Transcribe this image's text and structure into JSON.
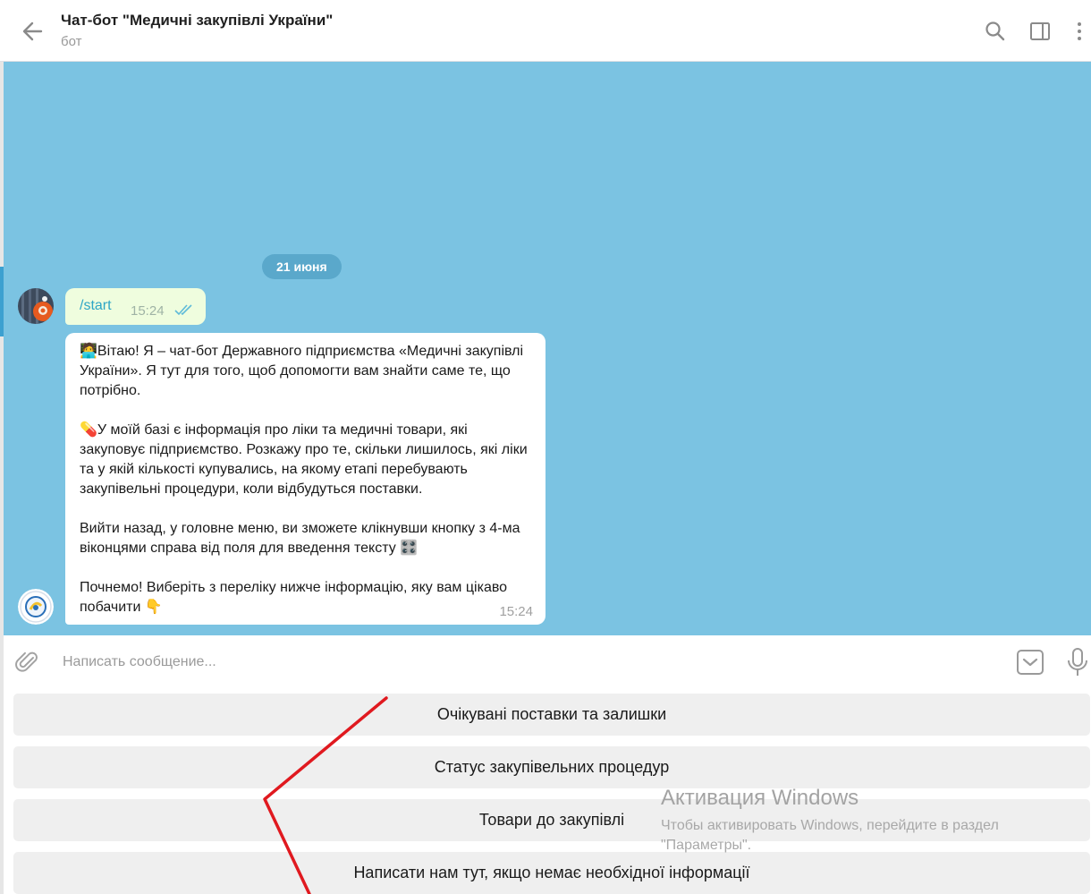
{
  "header": {
    "title": "Чат-бот \"Медичні закупівлі України\"",
    "subtitle": "бот"
  },
  "chat": {
    "date_label": "21 июня",
    "outgoing": {
      "text": "/start",
      "time": "15:24"
    },
    "incoming": {
      "paragraphs": [
        "🧑‍💻Вітаю! Я – чат-бот Державного підприємства «Медичні закупівлі України». Я тут для того, щоб допомогти вам знайти саме те, що потрібно.",
        "💊У моїй базі є інформація про ліки та медичні товари, які закуповує підприємство. Розкажу про те, скільки лишилось, які ліки та у якій кількості купувались, на якому етапі перебувають закупівельні процедури, коли відбудуться поставки.",
        "Вийти назад, у головне меню, ви зможете клікнувши кнопку з 4-ма віконцями справа від поля для введення тексту 🎛️",
        "Почнемо! Виберіть з переліку нижче інформацію, яку вам цікаво побачити 👇"
      ],
      "time": "15:24"
    }
  },
  "composer": {
    "placeholder": "Написать сообщение..."
  },
  "keyboard": {
    "buttons": [
      "Очікувані поставки та залишки",
      "Статус закупівельних процедур",
      "Товари до закупівлі",
      "Написати нам тут, якщо немає необхідної інформації"
    ]
  },
  "watermark": {
    "title": "Активация Windows",
    "text": "Чтобы активировать Windows, перейдите в раздел \"Параметры\"."
  },
  "colors": {
    "chat_background": "#7bc3e2",
    "outgoing_bubble": "#effdde",
    "link_text": "#2ea6c6",
    "annotation_red": "#e0191f"
  }
}
